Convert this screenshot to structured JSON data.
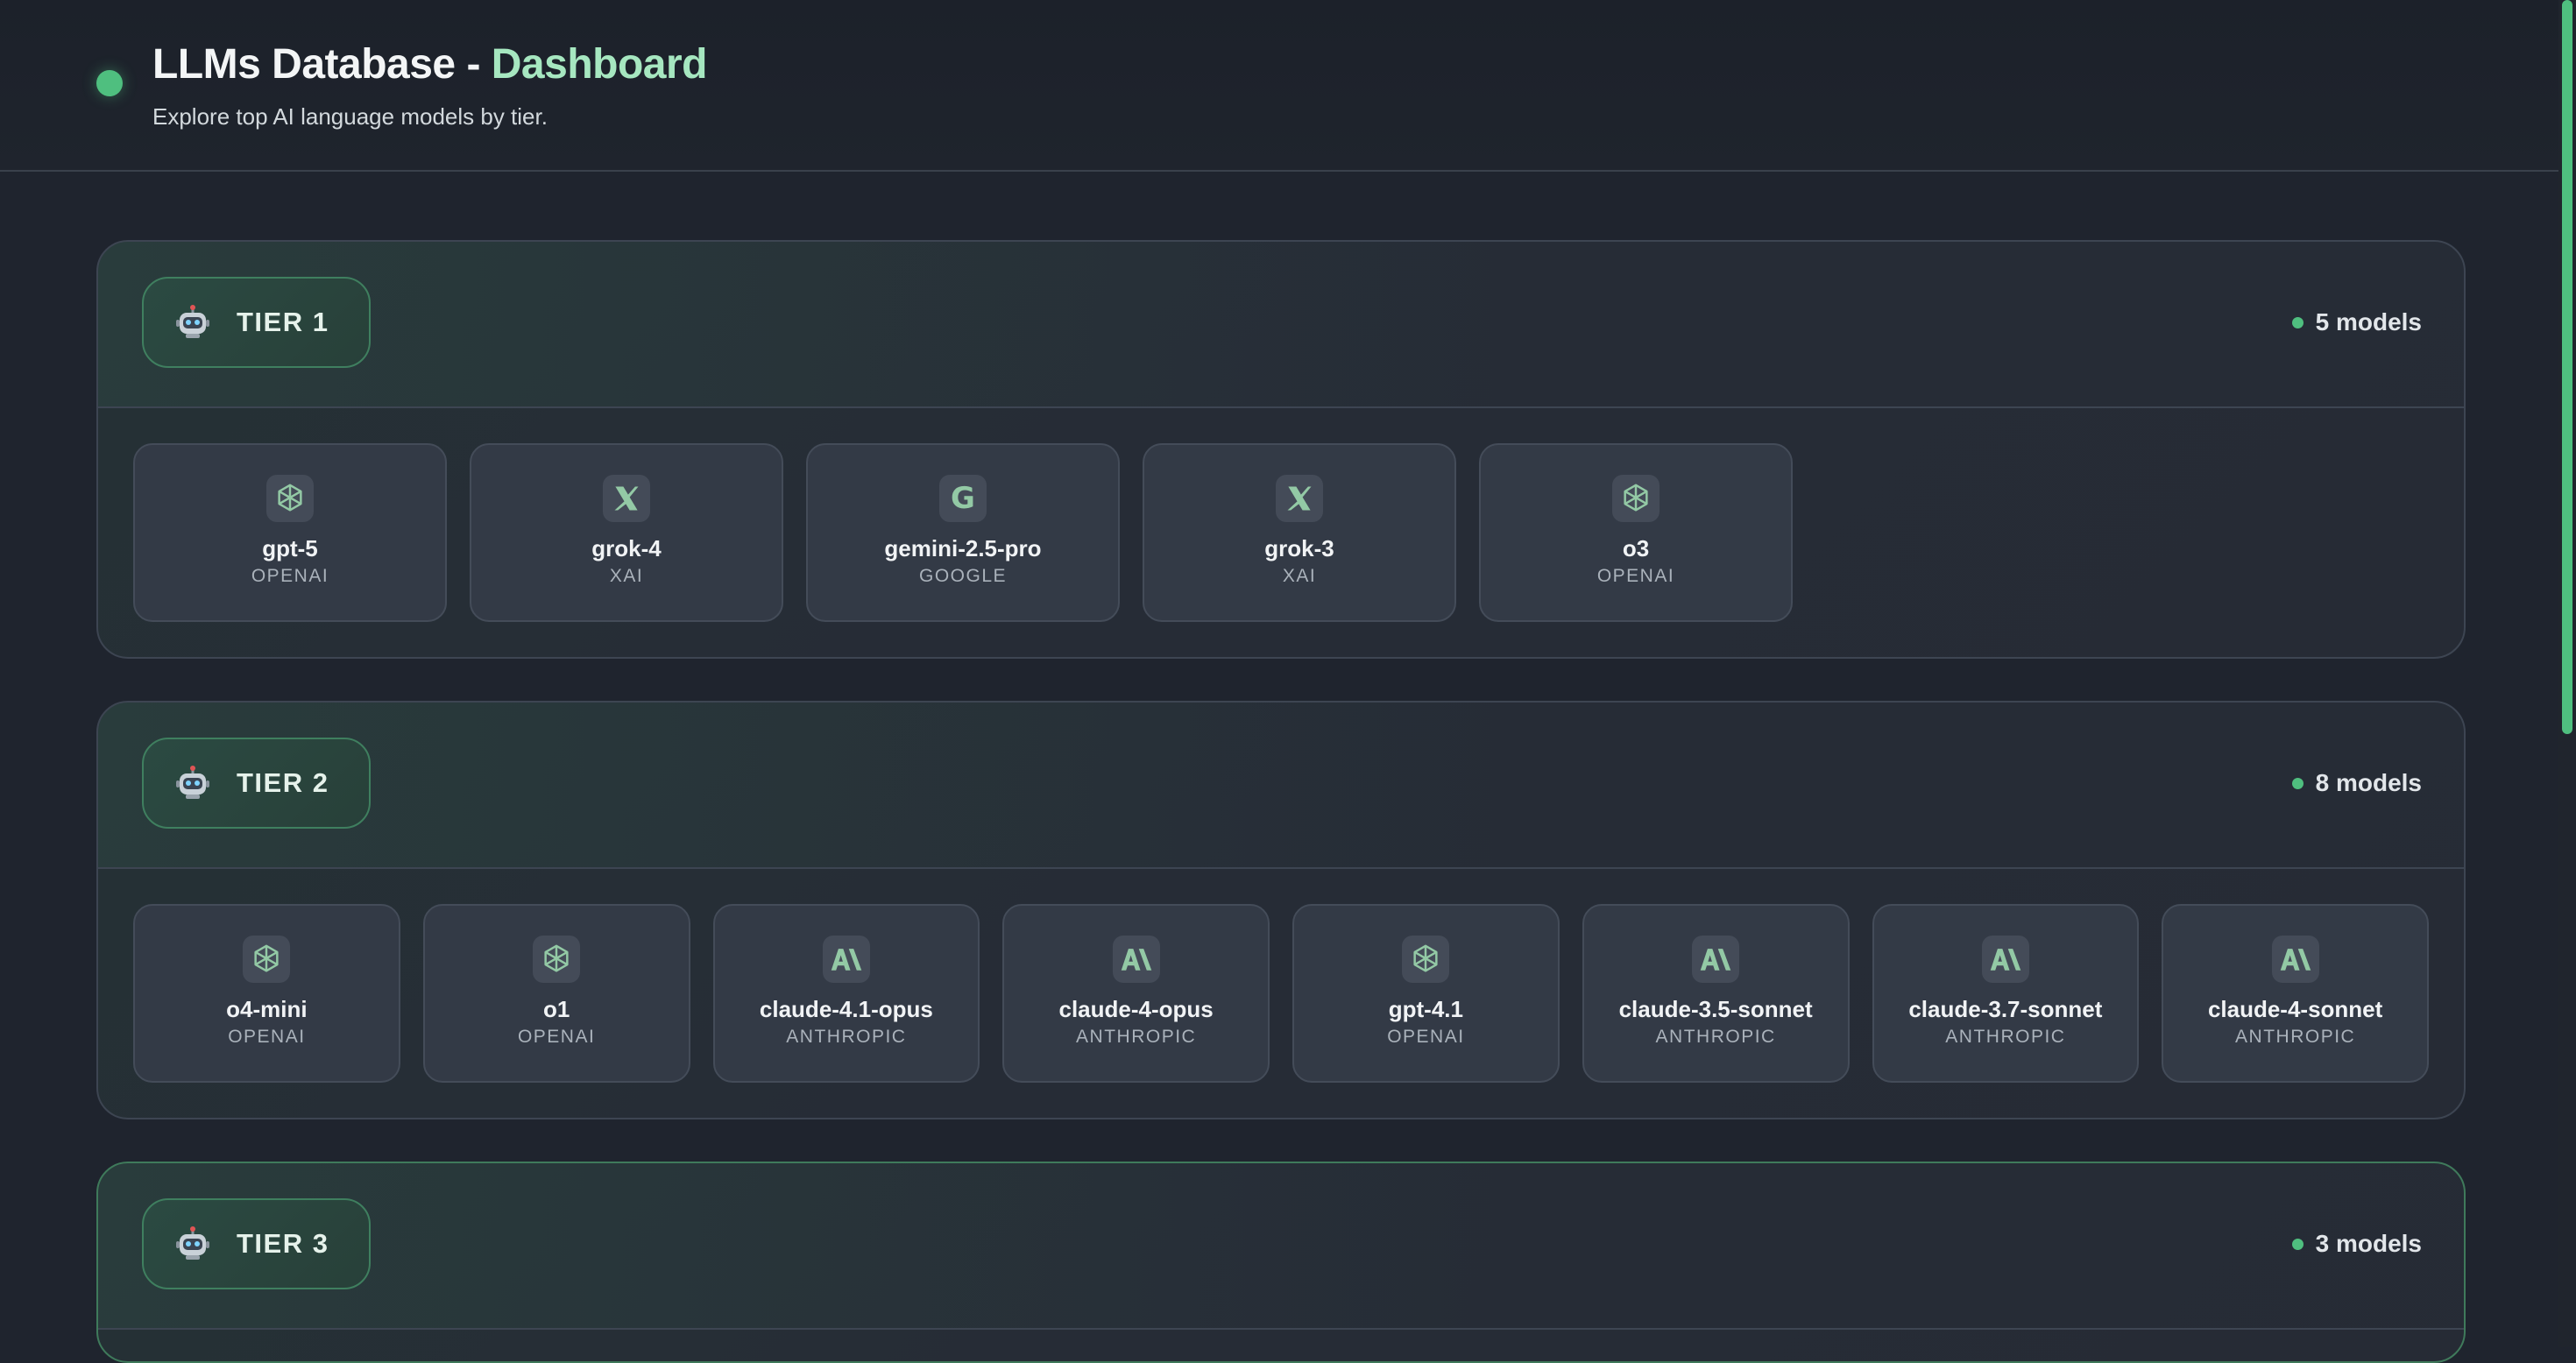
{
  "header": {
    "title_main": "LLMs Database - ",
    "title_accent": "Dashboard",
    "subtitle": "Explore top AI language models by tier."
  },
  "colors": {
    "accent": "#4fbf7f",
    "background": "#1f242e",
    "card": "#333a46"
  },
  "tiers": [
    {
      "label": "TIER 1",
      "count": "5 models",
      "models": [
        {
          "name": "gpt-5",
          "provider": "OPENAI",
          "icon": "openai-icon"
        },
        {
          "name": "grok-4",
          "provider": "XAI",
          "icon": "xai-icon"
        },
        {
          "name": "gemini-2.5-pro",
          "provider": "GOOGLE",
          "icon": "google-icon"
        },
        {
          "name": "grok-3",
          "provider": "XAI",
          "icon": "xai-icon"
        },
        {
          "name": "o3",
          "provider": "OPENAI",
          "icon": "openai-icon"
        }
      ]
    },
    {
      "label": "TIER 2",
      "count": "8 models",
      "models": [
        {
          "name": "o4-mini",
          "provider": "OPENAI",
          "icon": "openai-icon"
        },
        {
          "name": "o1",
          "provider": "OPENAI",
          "icon": "openai-icon"
        },
        {
          "name": "claude-4.1-opus",
          "provider": "ANTHROPIC",
          "icon": "anthropic-icon"
        },
        {
          "name": "claude-4-opus",
          "provider": "ANTHROPIC",
          "icon": "anthropic-icon"
        },
        {
          "name": "gpt-4.1",
          "provider": "OPENAI",
          "icon": "openai-icon"
        },
        {
          "name": "claude-3.5-sonnet",
          "provider": "ANTHROPIC",
          "icon": "anthropic-icon"
        },
        {
          "name": "claude-3.7-sonnet",
          "provider": "ANTHROPIC",
          "icon": "anthropic-icon"
        },
        {
          "name": "claude-4-sonnet",
          "provider": "ANTHROPIC",
          "icon": "anthropic-icon"
        }
      ]
    },
    {
      "label": "TIER 3",
      "count": "3 models",
      "models": []
    }
  ]
}
